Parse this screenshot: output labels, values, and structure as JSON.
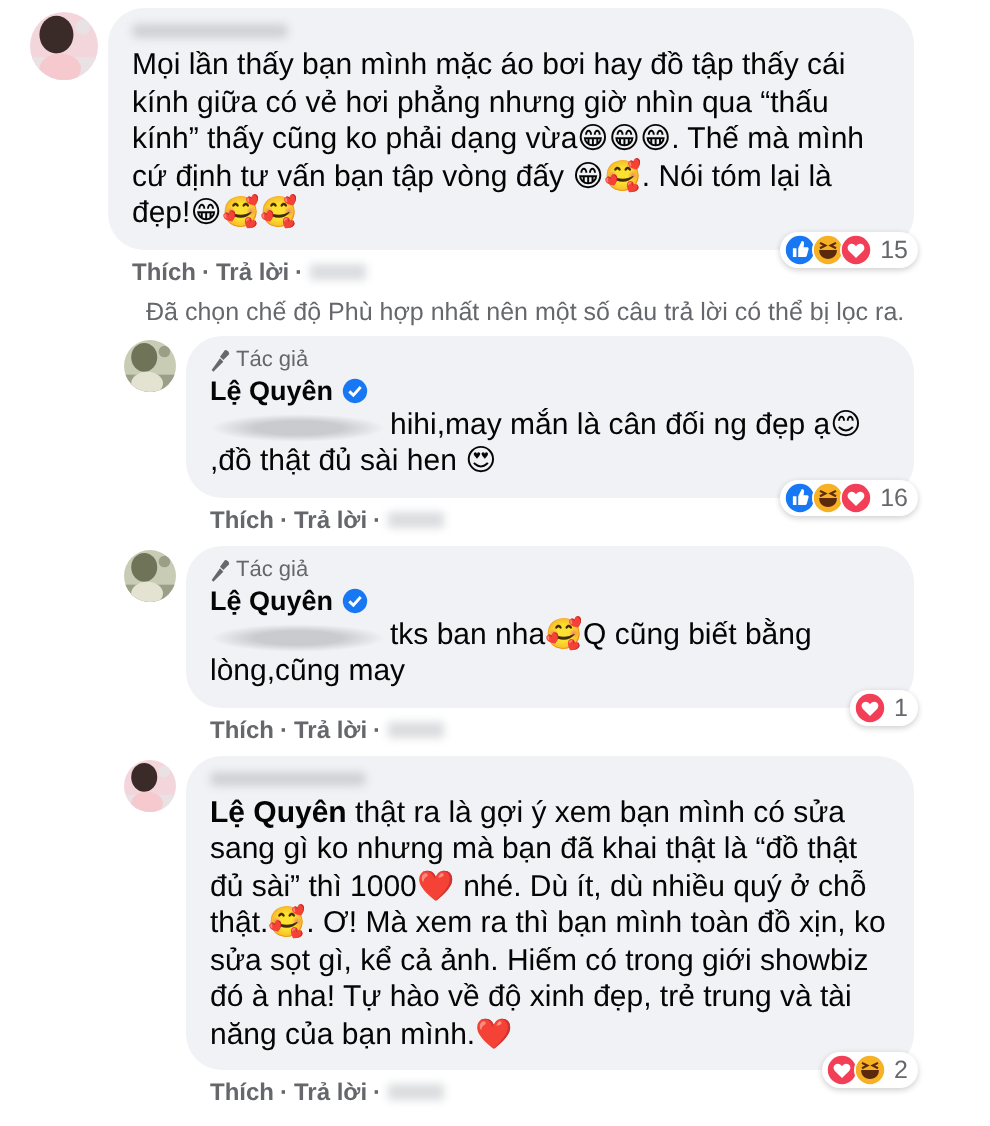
{
  "comments": [
    {
      "author_hidden": true,
      "avatar": {
        "kind": "picture"
      },
      "reply": false,
      "text": "Mọi lần thấy bạn mình mặc áo bơi hay đồ tập thấy cái kính giữa có vẻ hơi phẳng nhưng giờ nhìn qua “thấu kính” thấy cũng ko phải dạng vừa😁😁😁. Thế mà mình cứ định tư vấn bạn tập vòng đấy 😁🥰. Nói tóm lại là đẹp!😁🥰🥰",
      "reactions": [
        {
          "kind": "like",
          "color": "#1877f2"
        },
        {
          "kind": "haha",
          "color": "#f7b125"
        },
        {
          "kind": "love",
          "color": "#f33e58"
        }
      ],
      "count": "15",
      "actions": [
        "Thích",
        "·",
        "Trả lời",
        "·"
      ]
    },
    {
      "kind": "notice",
      "text": "Đã chọn chế độ Phù hợp nhất nên một số câu trả lời có thể bị lọc ra."
    },
    {
      "author_hidden": false,
      "author": "Lệ Quyên",
      "verified": true,
      "badge": "Tác giả",
      "avatar": {
        "kind": "picture"
      },
      "reply": true,
      "mention_hidden": true,
      "text": "hihi,may mắn là cân đối ng đẹp ạ😊 ,đồ thật đủ sài hen 😍",
      "reactions": [
        {
          "kind": "like",
          "color": "#1877f2"
        },
        {
          "kind": "haha",
          "color": "#f7b125"
        },
        {
          "kind": "love",
          "color": "#f33e58"
        }
      ],
      "count": "16",
      "actions": [
        "Thích",
        "·",
        "Trả lời",
        "·"
      ]
    },
    {
      "author_hidden": false,
      "author": "Lệ Quyên",
      "verified": true,
      "badge": "Tác giả",
      "avatar": {
        "kind": "picture"
      },
      "reply": true,
      "mention_hidden": true,
      "text": "tks ban nha🥰Q cũng biết bằng lòng,cũng may",
      "reactions": [
        {
          "kind": "love",
          "color": "#f33e58"
        }
      ],
      "count": "1",
      "actions": [
        "Thích",
        "·",
        "Trả lời",
        "·"
      ]
    },
    {
      "author_hidden": true,
      "avatar": {
        "kind": "picture"
      },
      "reply": true,
      "mention_hidden": false,
      "text": "**Lệ Quyên** thật ra là gợi ý xem bạn mình có sửa sang gì ko nhưng mà bạn đã khai thật là “đồ thật đủ sài” thì 1000❤️ nhé. Dù ít, dù nhiều quý ở chỗ thật.🥰. Ơ! Mà xem ra thì bạn mình toàn đồ xịn, ko sửa sọt gì, kể cả ảnh. Hiếm có trong giới showbiz đó à nha! Tự hào về độ xinh đẹp, trẻ trung và tài năng của bạn mình.❤️",
      "reactions": [
        {
          "kind": "love",
          "color": "#f33e58"
        },
        {
          "kind": "haha",
          "color": "#f7b125"
        }
      ],
      "count": "2",
      "actions": [
        "Thích",
        "·",
        "Trả lời",
        "·"
      ]
    }
  ]
}
